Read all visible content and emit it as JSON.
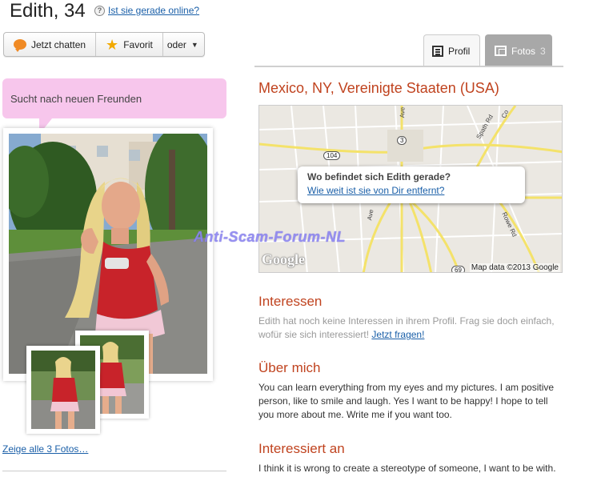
{
  "header": {
    "name_age": "Edith, 34",
    "help_icon_text": "?",
    "online_link": "Ist sie gerade online?"
  },
  "actions": {
    "chat_label": "Jetzt chatten",
    "favorite_label": "Favorit",
    "more_label": "oder",
    "chat_icon": "chat-bubble-icon",
    "favorite_icon": "star-icon"
  },
  "tabs": {
    "profile_label": "Profil",
    "photos_label": "Fotos",
    "photos_count": "3"
  },
  "bubble": {
    "text": "Sucht nach neuen Freunden"
  },
  "photos": {
    "all_photos_link": "Zeige alle 3 Fotos…"
  },
  "location": {
    "text": "Mexico, NY, Vereinigte Staaten (USA)"
  },
  "map": {
    "popup_question": "Wo befindet sich Edith gerade?",
    "popup_link": "Wie weit ist sie von Dir entfernt?",
    "provider_logo": "Google",
    "attribution": "Map data ©2013 Google",
    "route_signs": [
      "104",
      "3",
      "69"
    ],
    "road_labels": [
      "Ave",
      "Spath Rd",
      "Rowe Rd",
      "Co",
      "Ave"
    ]
  },
  "watermark": {
    "text": "Anti-Scam-Forum-NL"
  },
  "interests": {
    "title": "Interessen",
    "text": "Edith hat noch keine Interessen in ihrem Profil. Frag sie doch einfach, wofür sie sich interessiert!",
    "ask_link": "Jetzt fragen!"
  },
  "about": {
    "title": "Über mich",
    "text": "You can learn everything from my eyes and my pictures. I am positive person, like to smile and laugh. Yes I want to be happy! I hope to tell you more about me. Write me if you want too."
  },
  "interested_in": {
    "title": "Interessiert an",
    "text": "I think it is wrong to create a stereotype of someone, I want to be with."
  },
  "colors": {
    "accent": "#c0431f",
    "link": "#1a5fa8",
    "bubble": "#f7c6ec",
    "watermark": "#8b84f0"
  }
}
